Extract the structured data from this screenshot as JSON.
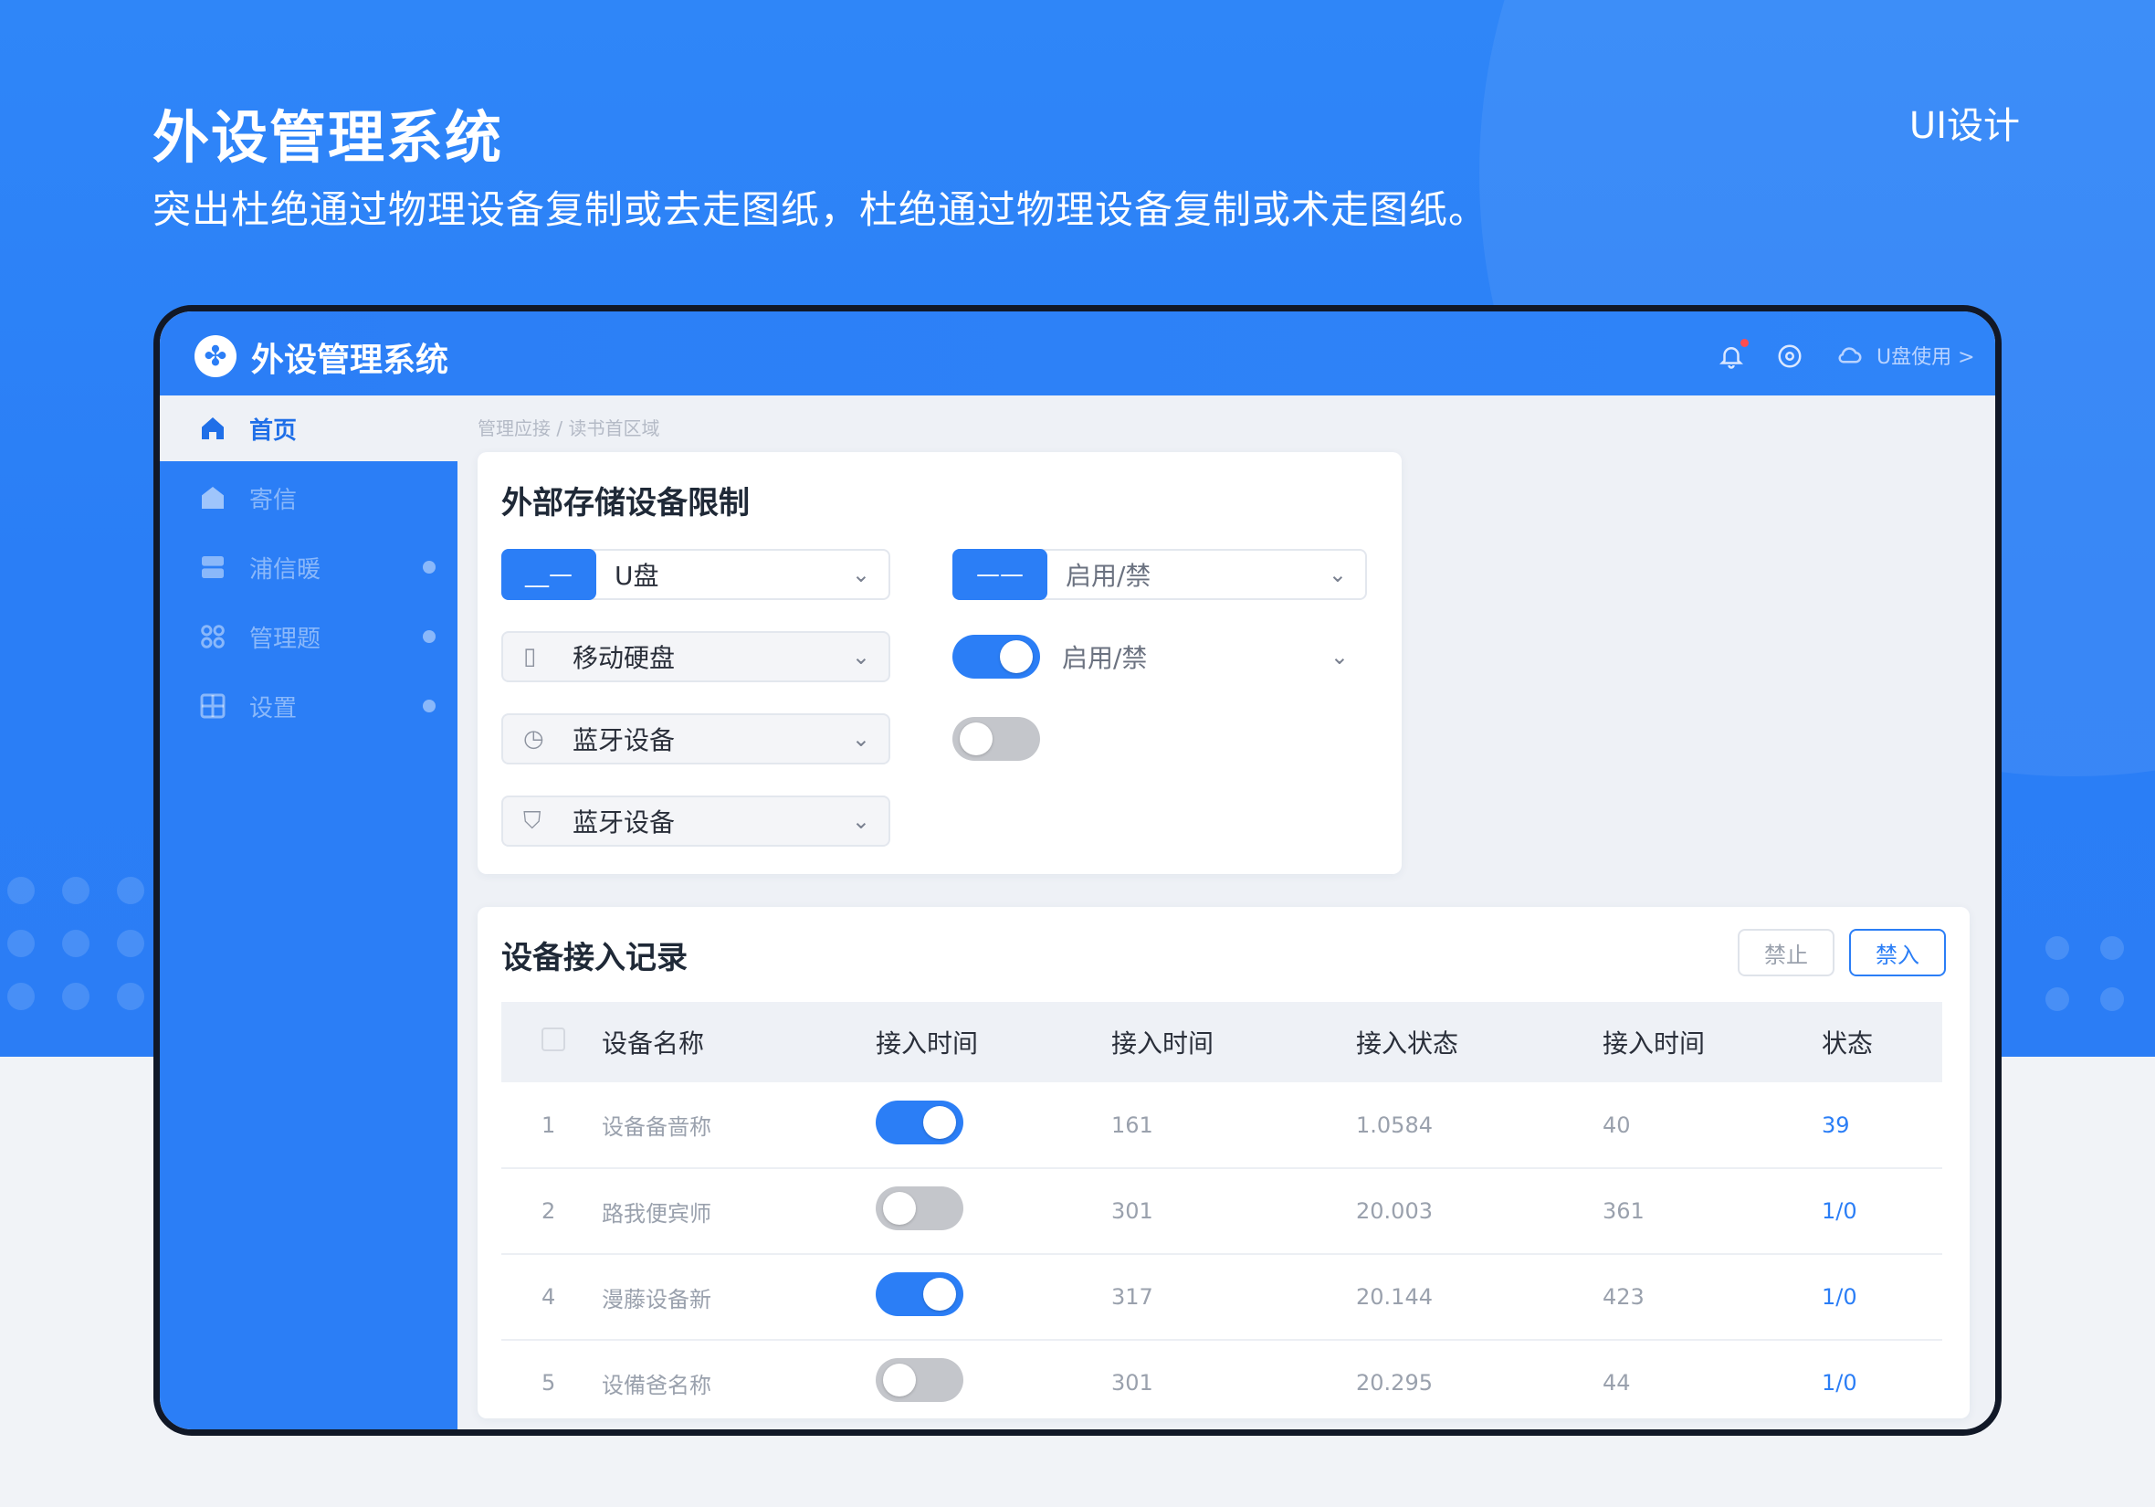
{
  "hero": {
    "title": "外设管理系统",
    "subtitle": "突出杜绝通过物理设备复制或去走图纸，杜绝通过物理设备复制或术走图纸。",
    "tag": "UI设计"
  },
  "app": {
    "name": "外设管理系统",
    "logo_icon": "pinwheel-logo",
    "user_link": "U盘使用 >",
    "icons": [
      "bell-icon",
      "help-icon",
      "cloud-icon"
    ]
  },
  "sidebar": {
    "items": [
      {
        "label": "首页",
        "icon": "home-icon"
      },
      {
        "label": "寄信",
        "icon": "store-icon"
      },
      {
        "label": "浦信暖",
        "icon": "storage-icon"
      },
      {
        "label": "管理题",
        "icon": "grid-icon"
      },
      {
        "label": "设置",
        "icon": "settings-icon"
      }
    ]
  },
  "breadcrumb": "管理应接 / 读书首区域",
  "storage_card": {
    "title": "外部存储设备限制",
    "selects": [
      {
        "value": "U盘",
        "pill": "__—"
      },
      {
        "value": "移动硬盘"
      },
      {
        "value": "蓝牙设备"
      },
      {
        "value": "蓝牙设备"
      }
    ],
    "right_selects": [
      {
        "value": "启用/禁",
        "pill": "——"
      },
      {
        "value": "启用/禁"
      }
    ],
    "toggles": [
      true,
      false
    ]
  },
  "records_card": {
    "title": "设备接入记录",
    "btn_disable": "禁止",
    "btn_enable": "禁入",
    "columns": [
      "设备名称",
      "接入时间",
      "接入时间",
      "接入状态",
      "接入时间",
      "状态"
    ],
    "rows": [
      {
        "no": "1",
        "name": "设备备啬称",
        "on": true,
        "t1": "161",
        "t2": "1.0584",
        "t3": "40",
        "status": "39"
      },
      {
        "no": "2",
        "name": "路我便宾师",
        "on": false,
        "t1": "301",
        "t2": "20.003",
        "t3": "361",
        "status": "1/0"
      },
      {
        "no": "4",
        "name": "漫藤设备新",
        "on": true,
        "t1": "317",
        "t2": "20.144",
        "t3": "423",
        "status": "1/0"
      },
      {
        "no": "5",
        "name": "设備爸名称",
        "on": false,
        "t1": "301",
        "t2": "20.295",
        "t3": "44",
        "status": "1/0"
      }
    ]
  },
  "colors": {
    "brand": "#2b7ef6",
    "frame": "#111827",
    "background": "#eef1f6"
  }
}
